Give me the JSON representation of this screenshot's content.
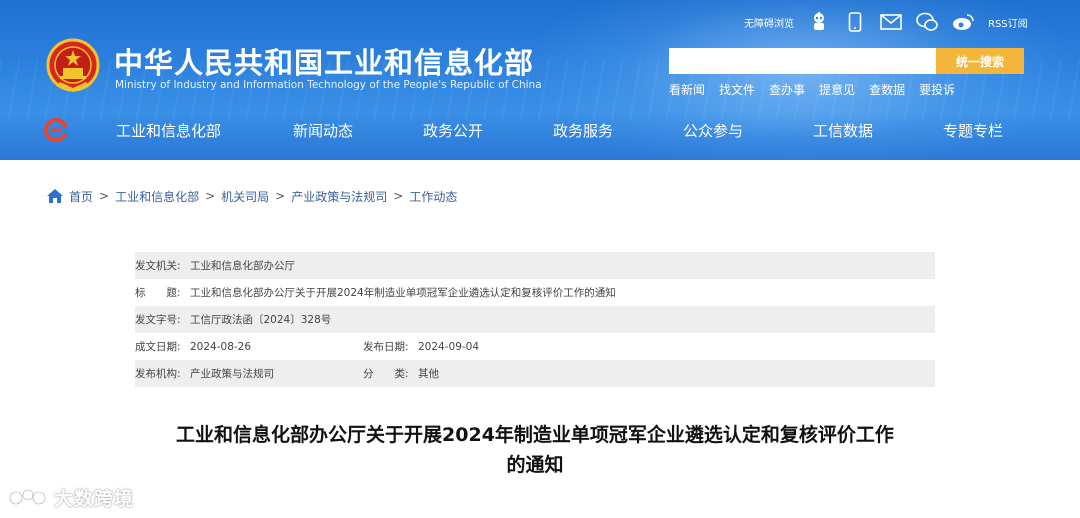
{
  "header": {
    "title": "中华人民共和国工业和信息化部",
    "subtitle": "Ministry of Industry and Information Technology of the People's Republic of China",
    "accessibility": "无障碍浏览",
    "rss": "RSS订阅",
    "search": {
      "placeholder": "",
      "button": "统一搜索"
    },
    "quick_links": [
      "看新闻",
      "找文件",
      "查办事",
      "提意见",
      "查数据",
      "要投诉"
    ]
  },
  "nav": {
    "items": [
      "工业和信息化部",
      "新闻动态",
      "政务公开",
      "政务服务",
      "公众参与",
      "工信数据",
      "专题专栏"
    ]
  },
  "breadcrumb": [
    "首页",
    "工业和信息化部",
    "机关司局",
    "产业政策与法规司",
    "工作动态"
  ],
  "meta": {
    "issuer_label": "发文机关:",
    "issuer": "工业和信息化部办公厅",
    "title_label": "标　　题:",
    "title": "工业和信息化部办公厅关于开展2024年制造业单项冠军企业遴选认定和复核评价工作的通知",
    "doc_no_label": "发文字号:",
    "doc_no": "工信厅政法函〔2024〕328号",
    "date_label": "成文日期:",
    "date": "2024-08-26",
    "publish_label": "发布日期:",
    "publish": "2024-09-04",
    "org_label": "发布机构:",
    "org": "产业政策与法规司",
    "category_label": "分　　类:",
    "category": "其他"
  },
  "document": {
    "title_line1": "工业和信息化部办公厅关于开展2024年制造业单项冠军企业遴选认定和复核评价工作",
    "title_line2": "的通知"
  },
  "watermark": {
    "text": "大数跨境"
  },
  "colors": {
    "header_blue": "#2f84e0",
    "search_button": "#f3b53a",
    "link": "#3a5f9a",
    "emblem_red": "#d8261c",
    "emblem_gold": "#f4c430"
  }
}
